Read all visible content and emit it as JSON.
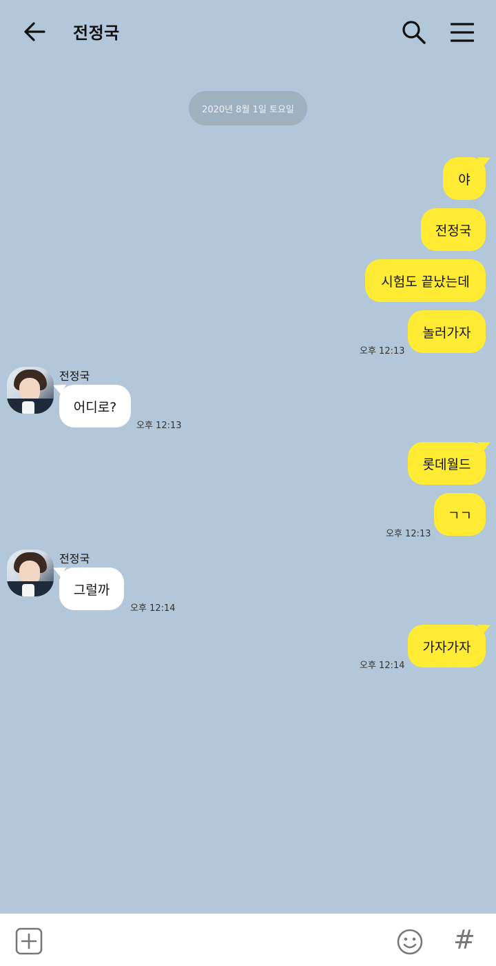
{
  "header": {
    "title": "전정국"
  },
  "date_divider": "2020년 8월 1일 토요일",
  "messages": [
    {
      "text": "야"
    },
    {
      "text": "전정국"
    },
    {
      "text": "시험도 끝났는데"
    },
    {
      "text": "놀러가자",
      "time": "오후 12:13"
    },
    {
      "sender": "전정국",
      "text": "어디로?",
      "time": "오후 12:13"
    },
    {
      "text": "롯데월드"
    },
    {
      "text": "ㄱㄱ",
      "time": "오후 12:13"
    },
    {
      "sender": "전정국",
      "text": "그럴까",
      "time": "오후 12:14"
    },
    {
      "text": "가자가자",
      "time": "오후 12:14"
    }
  ],
  "icons": {
    "back": "arrow-left-icon",
    "search": "search-icon",
    "menu": "hamburger-menu-icon",
    "plus": "plus-square-icon",
    "emoji": "emoji-icon",
    "hash": "hashtag-icon"
  },
  "bottom_bar": {
    "hash_symbol": "#"
  },
  "colors": {
    "background": "#b2c7da",
    "my_bubble": "#ffeb33",
    "their_bubble": "#ffffff",
    "date_pill": "#9fb0be"
  }
}
